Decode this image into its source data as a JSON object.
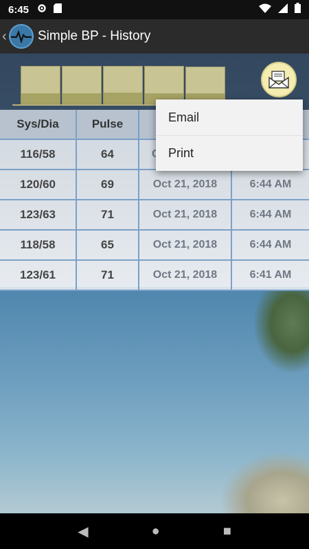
{
  "status_bar": {
    "time": "6:45",
    "icons": [
      "gear-icon",
      "sd-card-icon",
      "wifi-icon",
      "signal-icon",
      "battery-icon"
    ]
  },
  "app_bar": {
    "title": "Simple BP - History",
    "back": "‹"
  },
  "chart_data": {
    "type": "bar",
    "categories": [
      "",
      "",
      "",
      "",
      ""
    ],
    "series": [
      {
        "values": [
          123,
          118,
          123,
          120,
          116
        ]
      },
      {
        "values": [
          61,
          58,
          63,
          60,
          58
        ]
      }
    ]
  },
  "table": {
    "headers": [
      "Sys/Dia",
      "Pulse",
      "",
      ""
    ],
    "rows": [
      {
        "bp": "116/58",
        "pulse": "64",
        "date": "C",
        "time": ""
      },
      {
        "bp": "120/60",
        "pulse": "69",
        "date": "Oct 21, 2018",
        "time": "6:44 AM"
      },
      {
        "bp": "123/63",
        "pulse": "71",
        "date": "Oct 21, 2018",
        "time": "6:44 AM"
      },
      {
        "bp": "118/58",
        "pulse": "65",
        "date": "Oct 21, 2018",
        "time": "6:44 AM"
      },
      {
        "bp": "123/61",
        "pulse": "71",
        "date": "Oct 21, 2018",
        "time": "6:41 AM"
      }
    ]
  },
  "menu": {
    "items": [
      "Email",
      "Print"
    ]
  },
  "nav": {
    "back": "◀",
    "home": "●",
    "recents": "■"
  },
  "colors": {
    "bar_fill": "#c8c493",
    "bar_lower": "#a7a364",
    "fab": "#f4ecb1",
    "grid": "#7aa0c8"
  }
}
